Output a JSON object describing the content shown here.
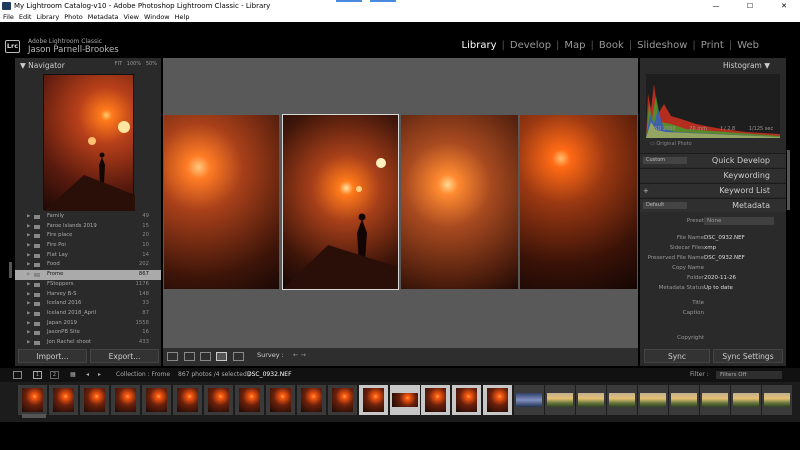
{
  "window": {
    "title": "My Lightroom Catalog-v10 - Adobe Photoshop Lightroom Classic - Library",
    "minimize": "—",
    "maximize": "☐",
    "close": "✕"
  },
  "menu": [
    "File",
    "Edit",
    "Library",
    "Photo",
    "Metadata",
    "View",
    "Window",
    "Help"
  ],
  "identity": {
    "logo": "Lrc",
    "line1": "Adobe Lightroom Classic",
    "line2": "Jason Parnell-Brookes"
  },
  "modules": [
    "Library",
    "Develop",
    "Map",
    "Book",
    "Slideshow",
    "Print",
    "Web"
  ],
  "navigator": {
    "title": "Navigator",
    "options": [
      "FIT",
      "100%",
      "50%"
    ]
  },
  "folders": [
    {
      "name": "Family",
      "count": "49"
    },
    {
      "name": "Faroe Islands 2019",
      "count": "15"
    },
    {
      "name": "Fire place",
      "count": "20"
    },
    {
      "name": "Fire Poi",
      "count": "10"
    },
    {
      "name": "Flat Lay",
      "count": "14"
    },
    {
      "name": "Food",
      "count": "202"
    },
    {
      "name": "Frome",
      "count": "867"
    },
    {
      "name": "FStoppers",
      "count": "1176"
    },
    {
      "name": "Harvey B-S",
      "count": "148"
    },
    {
      "name": "Iceland 2016",
      "count": "33"
    },
    {
      "name": "Iceland 2018_April",
      "count": "87"
    },
    {
      "name": "Japan 2019",
      "count": "1558"
    },
    {
      "name": "JasonPB Site",
      "count": "16"
    },
    {
      "name": "Jon Rachel shoot",
      "count": "433"
    }
  ],
  "left_buttons": {
    "import": "Import...",
    "export": "Export..."
  },
  "toolbar": {
    "survey": "Survey :",
    "arrows": "← →"
  },
  "histogram": {
    "title": "Histogram",
    "iso": "ISO 2000",
    "focal": "70 mm",
    "aperture": "f / 2.8",
    "shutter": "1/125 sec",
    "original": "Original Photo"
  },
  "quick_develop": {
    "preset": "Custom",
    "label": "Quick Develop"
  },
  "keywording": {
    "label": "Keywording"
  },
  "keyword_list": {
    "label": "Keyword List",
    "plus": "+"
  },
  "metadata": {
    "preset": "Default",
    "label": "Metadata",
    "preset_label": "Preset",
    "preset_value": "None",
    "file_name_label": "File Name",
    "file_name": "DSC_0932.NEF",
    "sidecar_label": "Sidecar Files",
    "sidecar": "xmp",
    "preserved_label": "Preserved File Name",
    "preserved": "DSC_0932.NEF",
    "copy_label": "Copy Name",
    "folder_label": "Folder",
    "folder": "2020-11-26",
    "status_label": "Metadata Status",
    "status": "Up to date",
    "title_label": "Title",
    "caption_label": "Caption",
    "copyright_label": "Copyright"
  },
  "sync": {
    "sync": "Sync",
    "settings": "Sync Settings"
  },
  "filmbar": {
    "pages": [
      "1",
      "2"
    ],
    "collection": "Collection : Frome",
    "counts": "867 photos /4 selected /",
    "current": "DSC_0932.NEF",
    "filter_label": "Filter :",
    "filter_value": "Filters Off"
  },
  "colors": {
    "accent": "#ff6a1a",
    "panel": "#2a2a2a",
    "center": "#595959",
    "selected": "#aaaaaa"
  }
}
